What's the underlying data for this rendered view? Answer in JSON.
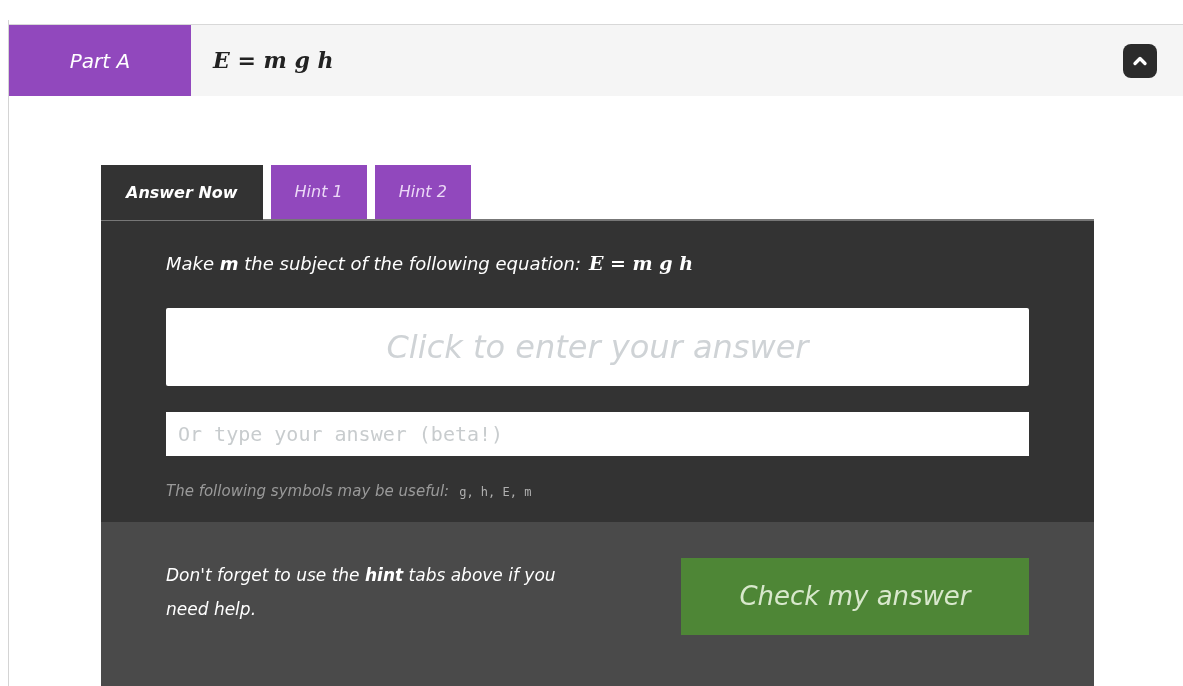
{
  "part": {
    "label": "Part A",
    "equation": "E = m g h"
  },
  "tabs": [
    {
      "label": "Answer Now",
      "selected": true
    },
    {
      "label": "Hint 1",
      "selected": false
    },
    {
      "label": "Hint 2",
      "selected": false
    }
  ],
  "question": {
    "text": "Make **m** the subject of the following equation:",
    "equation": "E = m g h"
  },
  "answer_box": {
    "placeholder": "Click to enter your answer"
  },
  "typed_answer": {
    "placeholder": "Or type your answer (beta!)"
  },
  "symbols": {
    "label": "The following symbols may be useful:",
    "list": "g, h, E, m"
  },
  "hint_note": "Don't forget to use the **hint** tabs above if you need help.",
  "check_button": "Check my answer"
}
